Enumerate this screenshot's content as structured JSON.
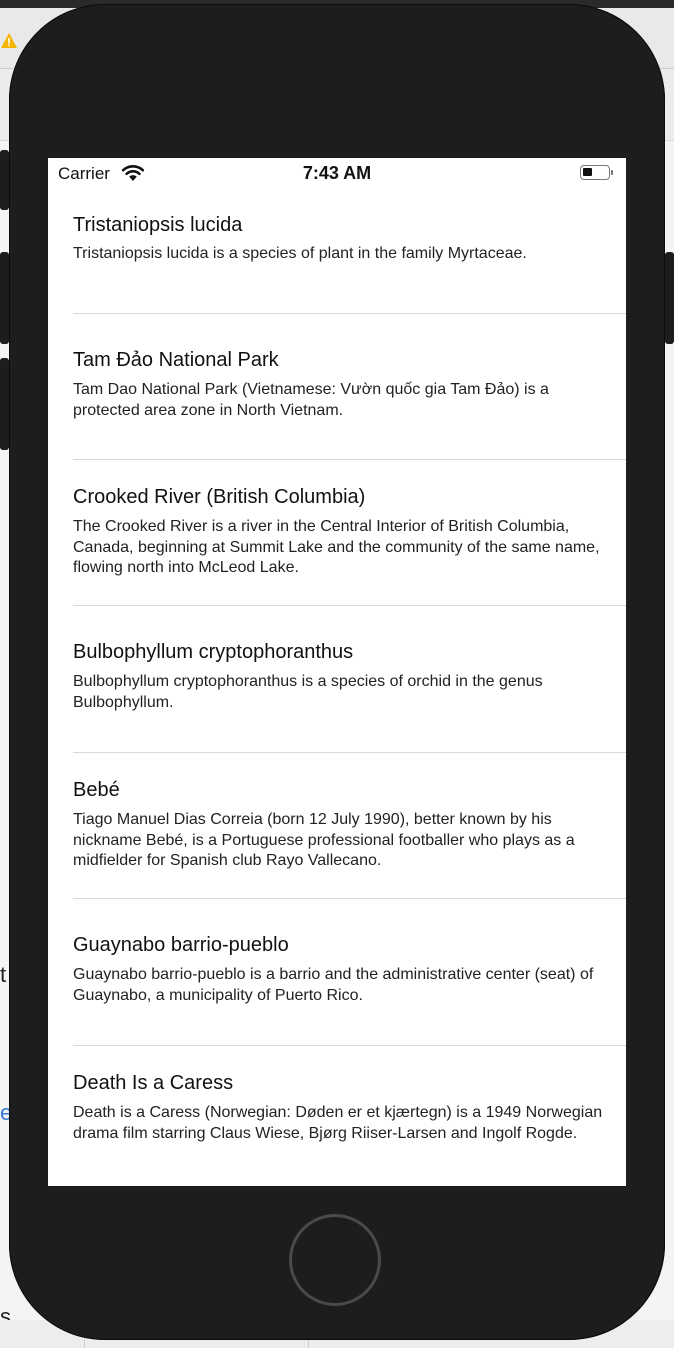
{
  "status_bar": {
    "carrier": "Carrier",
    "time": "7:43 AM",
    "wifi_icon": "wifi-icon",
    "battery_icon": "battery-icon"
  },
  "background_fragments": {
    "left_t": "t",
    "left_e": "e",
    "left_s": "s"
  },
  "articles": [
    {
      "title": "Tristaniopsis lucida",
      "description": "Tristaniopsis lucida is a species of plant in the family Myrtaceae."
    },
    {
      "title": "Tam Đảo National Park",
      "description": "Tam Dao National Park (Vietnamese: Vườn quốc gia Tam Đảo) is a protected area zone in North Vietnam."
    },
    {
      "title": "Crooked River (British Columbia)",
      "description": "The Crooked River is a river in the Central Interior of British Columbia, Canada, beginning at Summit Lake and the community of the same name, flowing north into McLeod Lake."
    },
    {
      "title": "Bulbophyllum cryptophoranthus",
      "description": "Bulbophyllum cryptophoranthus is a species of orchid in the genus Bulbophyllum."
    },
    {
      "title": "Bebé",
      "description": "Tiago Manuel Dias Correia (born 12 July 1990), better known by his nickname Bebé, is a Portuguese professional footballer who plays as a midfielder for Spanish club Rayo Vallecano."
    },
    {
      "title": "Guaynabo barrio-pueblo",
      "description": "Guaynabo barrio-pueblo  is a barrio and the administrative center (seat) of Guaynabo, a municipality of Puerto Rico."
    },
    {
      "title": "Death Is a Caress",
      "description": "Death is a Caress (Norwegian: Døden er et kjærtegn) is a 1949 Norwegian drama film starring Claus Wiese, Bjørg Riiser-Larsen and Ingolf Rogde."
    }
  ],
  "colors": {
    "device_body": "#1d1d1f",
    "screen_background": "#ffffff",
    "separator": "#d9d9d9",
    "warning_icon": "#f5b400"
  }
}
